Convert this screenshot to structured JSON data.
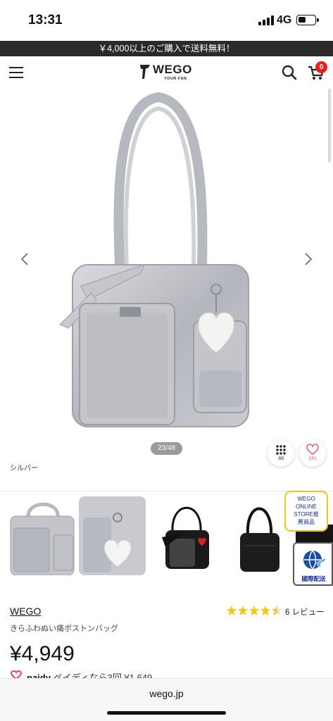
{
  "status_bar": {
    "time": "13:31",
    "network": "4G"
  },
  "promo": {
    "text": "￥4,000以上のご購入で送料無料！"
  },
  "header": {
    "logo_text": "WEGO",
    "logo_sub": "YOUR FAN",
    "cart_count": "0"
  },
  "gallery": {
    "counter": "23/48",
    "all_label": "All",
    "favorite_count": "241",
    "color_label": "シルバー"
  },
  "badges": {
    "store_line1": "WEGO",
    "store_line2": "ONLINE",
    "store_line3": "STORE推",
    "store_line4": "薦商品",
    "intl_label": "國際配送"
  },
  "product": {
    "brand": "WEGO",
    "name": "きらふわぬい痛ボストンバッグ",
    "rating_value": 4.5,
    "review_count": "6 レビュー",
    "price": "¥4,949",
    "paidy_brand": "paidy",
    "paidy_text": "ペイディなら3回 ¥1,649"
  },
  "browser": {
    "url": "wego.jp"
  },
  "colors": {
    "promo_bg": "#2a2a2a",
    "badge_red": "#e4221b",
    "star": "#f5c518"
  }
}
